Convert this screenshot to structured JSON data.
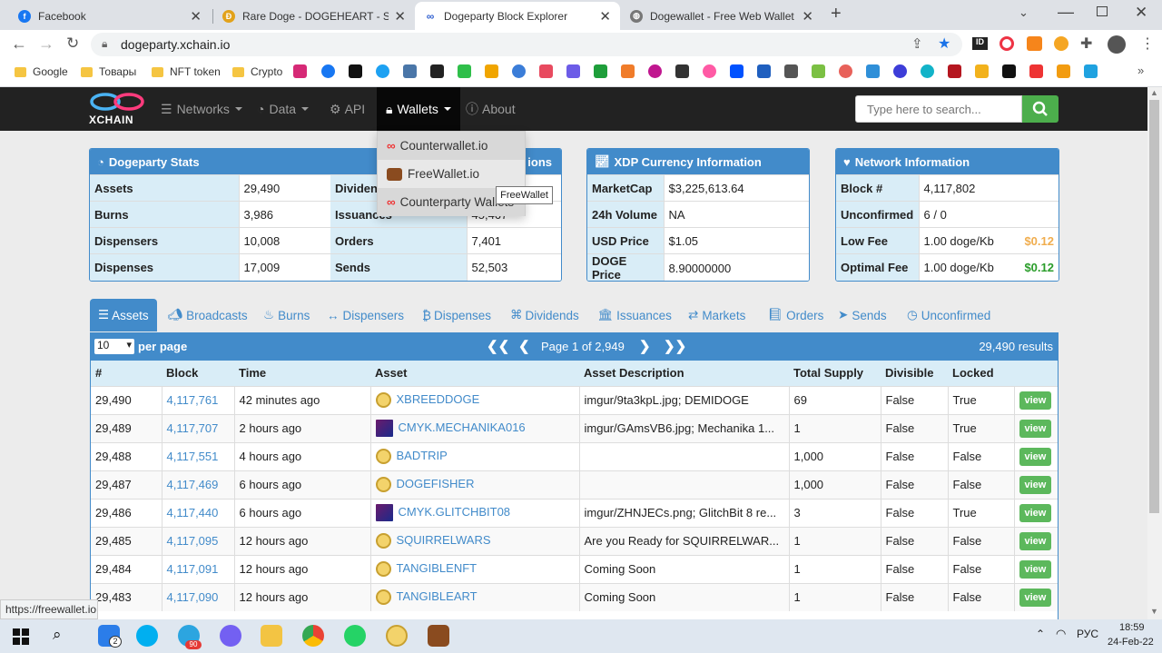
{
  "browser": {
    "tabs": [
      {
        "title": "Facebook",
        "color": "#1877f2"
      },
      {
        "title": "Rare Doge - DOGEHEART - Series",
        "color": "#e2a21a"
      },
      {
        "title": "Dogeparty Block Explorer",
        "color": "#2f5fd0"
      },
      {
        "title": "Dogewallet - Free Web Wallet fo",
        "color": "#666"
      }
    ],
    "new_tab": "+",
    "url": "dogeparty.xchain.io",
    "bookmarks": [
      "Google",
      "Товары",
      "NFT token",
      "Crypto"
    ],
    "status_url": "https://freewallet.io"
  },
  "nav": {
    "logo": "XCHAIN",
    "items": [
      {
        "label": "Networks",
        "icon": "database-icon"
      },
      {
        "label": "Data",
        "icon": "dashboard-icon"
      },
      {
        "label": "API",
        "icon": "gears-icon"
      },
      {
        "label": "Wallets",
        "icon": "lock-icon"
      },
      {
        "label": "About",
        "icon": "info-icon"
      }
    ],
    "search_placeholder": "Type here to search..."
  },
  "wallets_menu": {
    "items": [
      "Counterwallet.io",
      "FreeWallet.io",
      "Counterparty Wallets"
    ],
    "tooltip": "FreeWallet"
  },
  "stats": {
    "title": "Dogeparty Stats",
    "title2_suffix": "ions",
    "rows": [
      {
        "k1": "Assets",
        "v1": "29,490",
        "k2": "Dividen",
        "v2": ""
      },
      {
        "k1": "Burns",
        "v1": "3,986",
        "k2": "Issuances",
        "v2": "45,467"
      },
      {
        "k1": "Dispensers",
        "v1": "10,008",
        "k2": "Orders",
        "v2": "7,401"
      },
      {
        "k1": "Dispenses",
        "v1": "17,009",
        "k2": "Sends",
        "v2": "52,503"
      }
    ]
  },
  "currency": {
    "title": "XDP Currency Information",
    "rows": [
      {
        "k": "MarketCap",
        "v": "$3,225,613.64"
      },
      {
        "k": "24h Volume",
        "v": "NA"
      },
      {
        "k": "USD Price",
        "v": "$1.05"
      },
      {
        "k": "DOGE Price",
        "v": "8.90000000"
      }
    ]
  },
  "network": {
    "title": "Network Information",
    "rows": [
      {
        "k": "Block #",
        "v": "4,117,802",
        "extra": ""
      },
      {
        "k": "Unconfirmed",
        "v": "6 / 0",
        "extra": ""
      },
      {
        "k": "Low Fee",
        "v": "1.00 doge/Kb",
        "extra": "$0.12"
      },
      {
        "k": "Optimal Fee",
        "v": "1.00 doge/Kb",
        "extra": "$0.12"
      }
    ],
    "extra_colors": [
      "#f0ad4e",
      "#2a9d2a"
    ]
  },
  "tabs": [
    "Assets",
    "Broadcasts",
    "Burns",
    "Dispensers",
    "Dispenses",
    "Dividends",
    "Issuances",
    "Markets",
    "Orders",
    "Sends",
    "Unconfirmed"
  ],
  "pager": {
    "per_page": "10",
    "per_page_label": "per page",
    "page_text": "Page 1 of 2,949",
    "first": "❮❮",
    "prev": "❮",
    "next": "❯",
    "last": "❯❯",
    "results": "29,490 results"
  },
  "table": {
    "headers": [
      "#",
      "Block",
      "Time",
      "Asset",
      "Asset Description",
      "Total Supply",
      "Divisible",
      "Locked",
      ""
    ],
    "view_label": "view",
    "rows": [
      {
        "n": "29,490",
        "block": "4,117,761",
        "time": "42 minutes ago",
        "asset": "XBREEDDOGE",
        "desc": "imgur/9ta3kpL.jpg; DEMIDOGE",
        "supply": "69",
        "div": "False",
        "locked": "True",
        "icon": "coin"
      },
      {
        "n": "29,489",
        "block": "4,117,707",
        "time": "2 hours ago",
        "asset": "CMYK.MECHANIKA016",
        "desc": "imgur/GAmsVB6.jpg; Mechanika 1...",
        "supply": "1",
        "div": "False",
        "locked": "True",
        "icon": "image"
      },
      {
        "n": "29,488",
        "block": "4,117,551",
        "time": "4 hours ago",
        "asset": "BADTRIP",
        "desc": "",
        "supply": "1,000",
        "div": "False",
        "locked": "False",
        "icon": "coin"
      },
      {
        "n": "29,487",
        "block": "4,117,469",
        "time": "6 hours ago",
        "asset": "DOGEFISHER",
        "desc": "",
        "supply": "1,000",
        "div": "False",
        "locked": "False",
        "icon": "coin"
      },
      {
        "n": "29,486",
        "block": "4,117,440",
        "time": "6 hours ago",
        "asset": "CMYK.GLITCHBIT08",
        "desc": "imgur/ZHNJECs.png; GlitchBit 8 re...",
        "supply": "3",
        "div": "False",
        "locked": "True",
        "icon": "image"
      },
      {
        "n": "29,485",
        "block": "4,117,095",
        "time": "12 hours ago",
        "asset": "SQUIRRELWARS",
        "desc": "Are you Ready for SQUIRRELWAR...",
        "supply": "1",
        "div": "False",
        "locked": "False",
        "icon": "coin"
      },
      {
        "n": "29,484",
        "block": "4,117,091",
        "time": "12 hours ago",
        "asset": "TANGIBLENFT",
        "desc": "Coming Soon",
        "supply": "1",
        "div": "False",
        "locked": "False",
        "icon": "coin"
      },
      {
        "n": "29,483",
        "block": "4,117,090",
        "time": "12 hours ago",
        "asset": "TANGIBLEART",
        "desc": "Coming Soon",
        "supply": "1",
        "div": "False",
        "locked": "False",
        "icon": "coin"
      }
    ]
  },
  "taskbar": {
    "lang": "РУС",
    "time": "18:59",
    "date": "24-Feb-22",
    "badge_explorer": "2",
    "badge_telegram": "90"
  }
}
